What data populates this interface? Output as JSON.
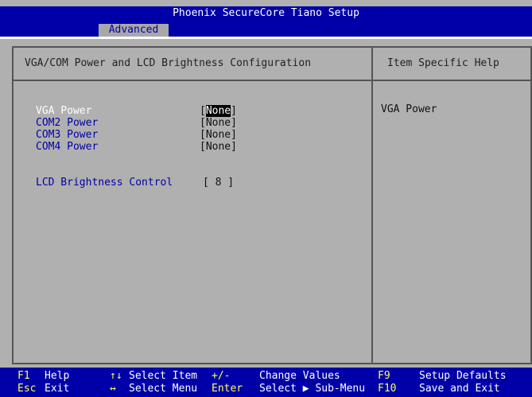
{
  "title": "Phoenix SecureCore Tiano Setup",
  "tabs": {
    "active": "Advanced"
  },
  "panel": {
    "left_title": "VGA/COM Power and LCD Brightness Configuration",
    "right_title": "Item Specific Help",
    "help_text": "VGA Power"
  },
  "items": [
    {
      "label": "VGA Power",
      "value_open": "[",
      "value_hl": "None",
      "value_close": "]",
      "selected": true
    },
    {
      "label": "COM2 Power",
      "value": "[None]"
    },
    {
      "label": "COM3 Power",
      "value": "[None]"
    },
    {
      "label": "COM4 Power",
      "value": "[None]"
    },
    {
      "label": "LCD Brightness Control",
      "value": "[ 8 ]"
    }
  ],
  "footer": {
    "row1": [
      {
        "key": "F1",
        "desc": "Help"
      },
      {
        "key": "↑↓",
        "desc": "Select Item"
      },
      {
        "key": "+/-",
        "desc": "Change Values"
      },
      {
        "key": "F9",
        "desc": "Setup Defaults"
      }
    ],
    "row2": [
      {
        "key": "Esc",
        "desc": "Exit"
      },
      {
        "key": "↔",
        "desc": "Select Menu"
      },
      {
        "key": "Enter",
        "desc": "Select ▶ Sub-Menu"
      },
      {
        "key": "F10",
        "desc": "Save and Exit"
      }
    ]
  }
}
